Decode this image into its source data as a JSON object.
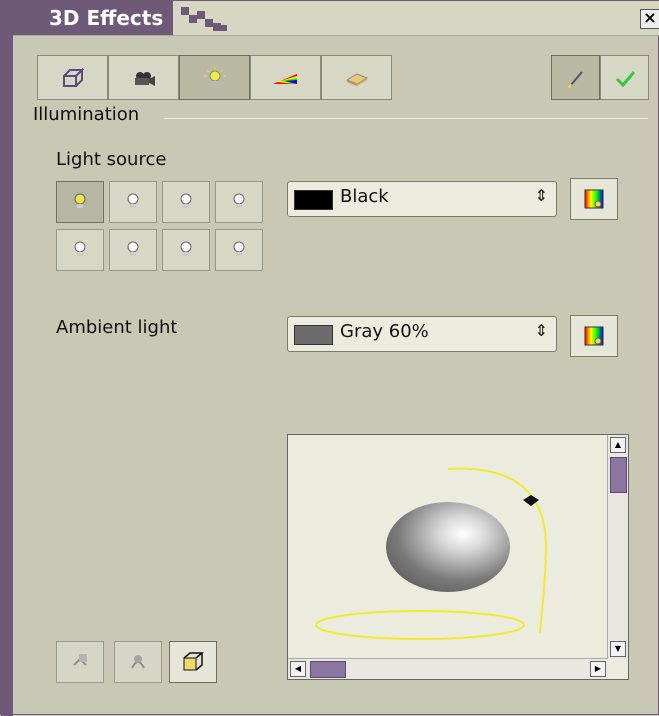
{
  "window": {
    "title": "3D Effects"
  },
  "toolbar": {
    "buttons": [
      {
        "icon": "geometry-icon"
      },
      {
        "icon": "camera-icon"
      },
      {
        "icon": "light-icon"
      },
      {
        "icon": "gradient-icon"
      },
      {
        "icon": "material-icon"
      },
      {
        "icon": "edit-icon"
      },
      {
        "icon": "check-icon"
      }
    ]
  },
  "section": {
    "illumination": "Illumination",
    "light_source": "Light source",
    "ambient_light": "Ambient light"
  },
  "light_colors": {
    "source_color": "Black",
    "ambient_color": "Gray 60%",
    "source_swatch": "#000000",
    "ambient_swatch": "#6b6b6b"
  },
  "window_chrome": {
    "close_symbol": "×"
  }
}
